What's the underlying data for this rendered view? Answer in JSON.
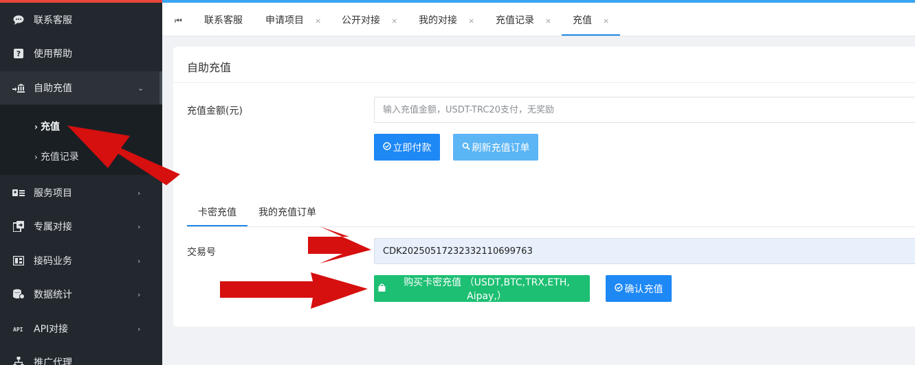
{
  "sidebar": {
    "items": [
      {
        "label": "联系客服",
        "icon": "chat-bubble-icon"
      },
      {
        "label": "使用帮助",
        "icon": "question-icon"
      },
      {
        "label": "自助充值",
        "icon": "bank-icon"
      },
      {
        "label": "服务项目",
        "icon": "id-card-icon"
      },
      {
        "label": "专属对接",
        "icon": "connect-icon"
      },
      {
        "label": "接码业务",
        "icon": "code-icon"
      },
      {
        "label": "数据统计",
        "icon": "database-icon"
      },
      {
        "label": "API对接",
        "icon": "api-icon"
      },
      {
        "label": "推广代理",
        "icon": "network-icon"
      }
    ],
    "submenu": [
      {
        "label": "充值"
      },
      {
        "label": "充值记录"
      }
    ]
  },
  "tabs": [
    {
      "label": "联系客服"
    },
    {
      "label": "申请项目"
    },
    {
      "label": "公开对接"
    },
    {
      "label": "我的对接"
    },
    {
      "label": "充值记录"
    },
    {
      "label": "充值"
    }
  ],
  "tab_close": "×",
  "card": {
    "title": "自助充值",
    "amount_label": "充值金额(元)",
    "amount_placeholder": "输入充值金额，USDT-TRC20支付，无奖励",
    "pay_button": "立即付款",
    "refresh_button": "刷新充值订单",
    "subtabs": [
      {
        "label": "卡密充值"
      },
      {
        "label": "我的充值订单"
      }
    ],
    "txn_label": "交易号",
    "txn_value": "CDK202505172323321106997​63",
    "buy_button": "购买卡密充值 （USDT,BTC,TRX,ETH, Aipay,）",
    "confirm_button": "确认充值"
  },
  "colors": {
    "sidebar_bg": "#22282e",
    "accent_blue": "#1e88f5",
    "green": "#1dbf73",
    "arrow_red": "#d90f0f"
  }
}
